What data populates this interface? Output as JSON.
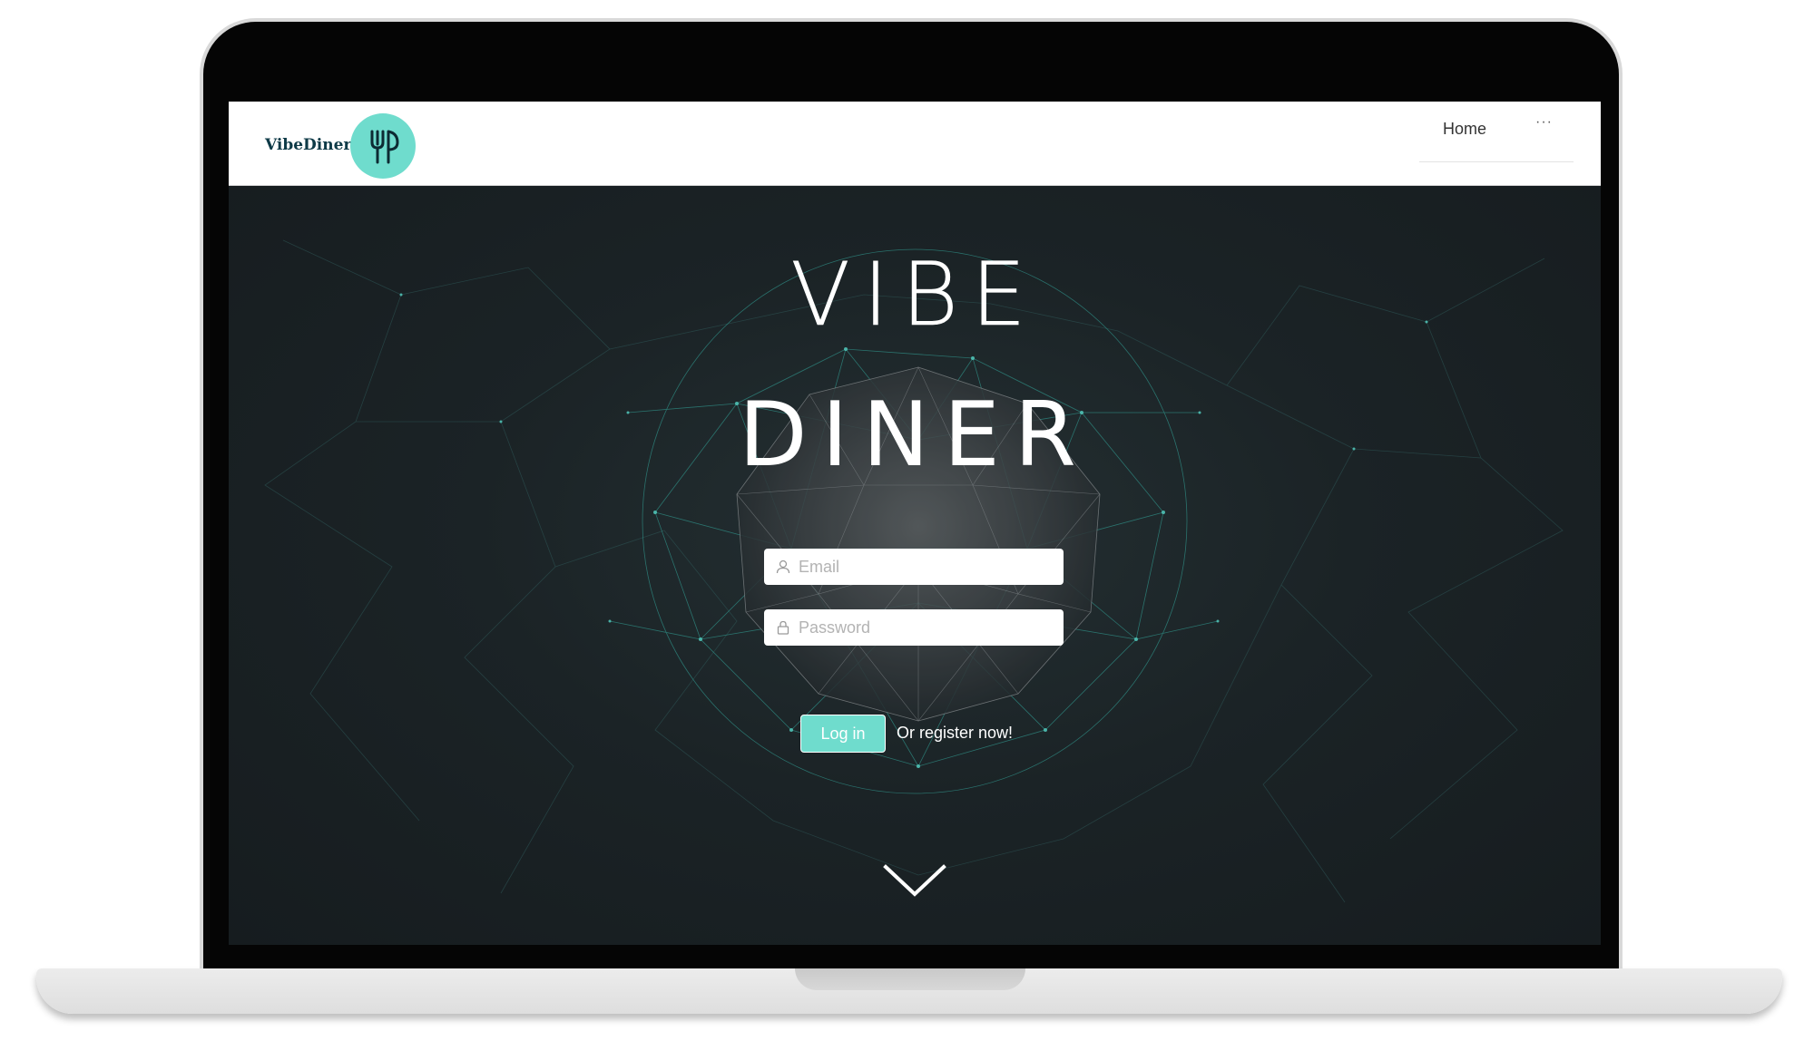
{
  "header": {
    "brand": "VibeDiner",
    "nav": {
      "home_label": "Home",
      "more_label": "···"
    }
  },
  "hero": {
    "title_line1": "VIBE",
    "title_line2": "DINER",
    "email": {
      "placeholder": "Email",
      "value": "",
      "icon": "user-icon"
    },
    "password": {
      "placeholder": "Password",
      "value": "",
      "icon": "lock-icon"
    },
    "login_label": "Log in",
    "register_label": "Or register now!",
    "scroll_icon": "chevron-down-icon"
  },
  "colors": {
    "accent": "#6fdccd",
    "brand_text": "#0e3a47",
    "hero_background": "#1b2326",
    "header_background": "#ffffff"
  }
}
